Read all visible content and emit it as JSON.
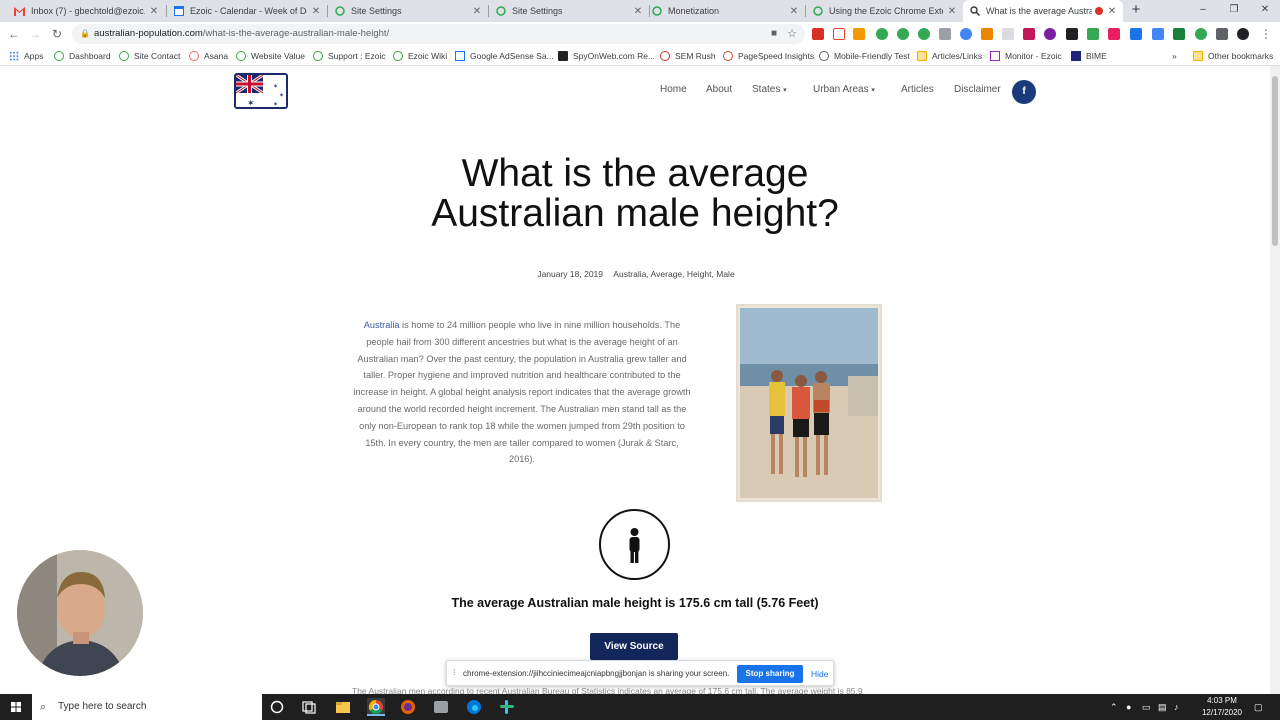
{
  "tabs": [
    {
      "title": "Inbox (7) - gbechtold@ezoic.com",
      "icon": "gmail-icon"
    },
    {
      "title": "Ezoic - Calendar - Week of Dece",
      "icon": "calendar-icon"
    },
    {
      "title": "Site Settings",
      "icon": "ezoic-icon"
    },
    {
      "title": "Site Settings",
      "icon": "ezoic-icon"
    },
    {
      "title": "Monetization",
      "icon": "ezoic-icon"
    },
    {
      "title": "Using the Ezoic Chrome Extensio",
      "icon": "ezoic-icon"
    },
    {
      "title": "What is the average Australia",
      "icon": "search-icon"
    }
  ],
  "address": {
    "domain": "australian-population.com",
    "path": "/what-is-the-average-australian-male-height/"
  },
  "bookmarks": {
    "apps": "Apps",
    "items": [
      "Dashboard",
      "Site Contact",
      "Asana",
      "Website Value",
      "Support : Ezoic",
      "Ezoic Wiki",
      "Google AdSense Sa...",
      "SpyOnWeb.com Re...",
      "SEM Rush",
      "PageSpeed Insights",
      "Mobile-Friendly Test",
      "Articles/Links",
      "Monitor - Ezoic",
      "BIME"
    ],
    "more": "»",
    "other": "Other bookmarks"
  },
  "site": {
    "nav": [
      "Home",
      "About",
      "States",
      "Urban Areas",
      "Articles",
      "Disclaimer"
    ],
    "facebook": "f"
  },
  "article": {
    "title_line1": "What is the average",
    "title_line2": "Australian male height?",
    "date": "January 18, 2019",
    "cat_sep": ",",
    "categories": [
      "Australia",
      "Average",
      "Height",
      "Male"
    ],
    "link_word": "Australia",
    "body": " is home to 24 million people who live in nine million households. The people hail from 300 different ancestries but what is the average height of an Australian man? Over the past century, the population in Australia grew taller and taller. Proper hygiene and improved nutrition and healthcare contributed to the increase in height.  A global height analysis report indicates that the average growth around the world recorded height increment. The Australian men stand tall as the only non-European to rank top 18 while the women jumped from 29th position to 15th. In every country, the men are taller compared to women (Jurak & Starc, 2016).",
    "answer": "The average Australian male height is 175.6 cm tall (5.76 Feet)",
    "view_source": "View Source",
    "cut_text": "The Australian men according to recent Australian Bureau of Statistics indicates an average of 175.6 cm tall. The average weight is 85.9"
  },
  "sharebar": {
    "message": "chrome-extension://jiihcciniecimeajcniapbngjjbonjan is sharing your screen.",
    "stop": "Stop sharing",
    "hide": "Hide"
  },
  "taskbar": {
    "search_placeholder": "Type here to search",
    "time": "4:03 PM",
    "date": "12/17/2020"
  },
  "colors": {
    "accent_navy": "#13265c",
    "link": "#3b5fa5",
    "chrome_blue": "#1a73e8"
  }
}
